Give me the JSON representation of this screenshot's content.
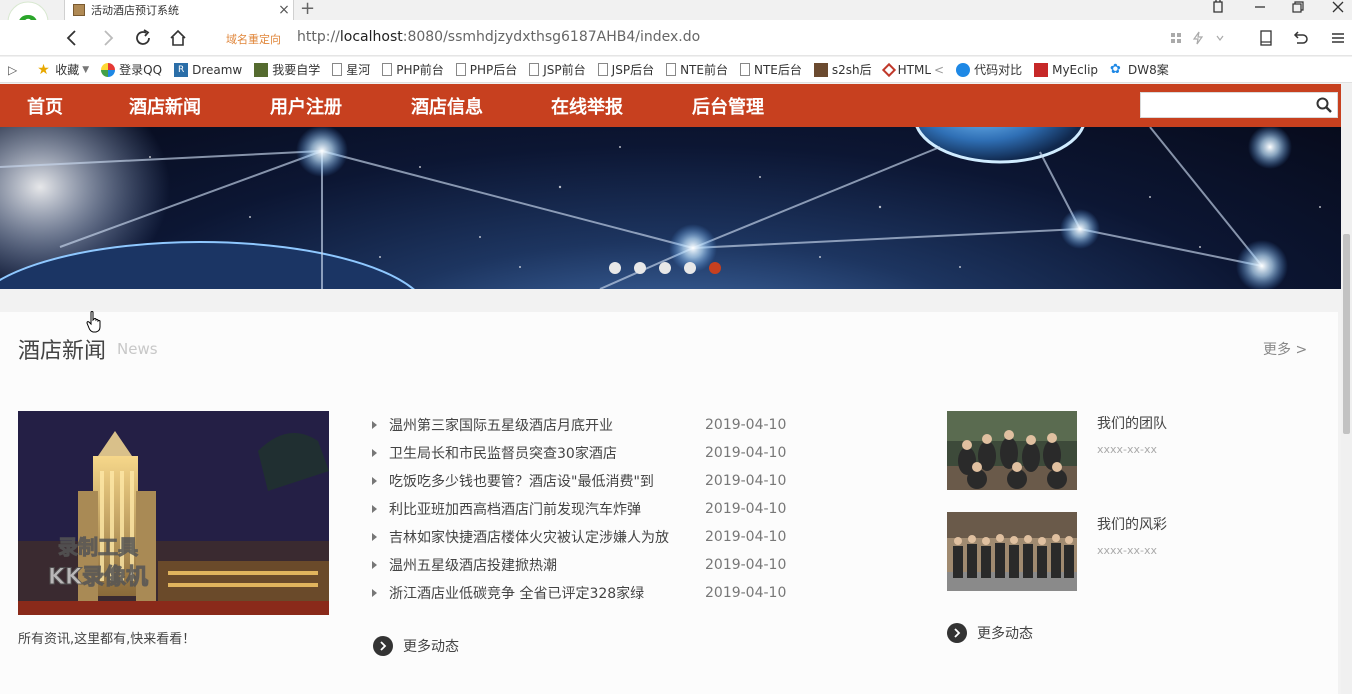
{
  "browser": {
    "tab_title": "活动酒店预订系统",
    "redirect_label": "域名重定向",
    "url_prefix": "http://",
    "url_host": "localhost",
    "url_rest": ":8080/ssmhdjzydxthsg6187AHB4/index.do",
    "bookmarks": [
      {
        "label": "收藏",
        "icon": "star-icon"
      },
      {
        "label": "登录QQ",
        "icon": "qq-icon"
      },
      {
        "label": "Dreamw",
        "icon": "dreamweaver-icon"
      },
      {
        "label": "我要自学",
        "icon": "site-icon"
      },
      {
        "label": "星河",
        "icon": "doc-icon"
      },
      {
        "label": "PHP前台",
        "icon": "doc-icon"
      },
      {
        "label": "PHP后台",
        "icon": "doc-icon"
      },
      {
        "label": "JSP前台",
        "icon": "doc-icon"
      },
      {
        "label": "JSP后台",
        "icon": "doc-icon"
      },
      {
        "label": "NTE前台",
        "icon": "doc-icon"
      },
      {
        "label": "NTE后台",
        "icon": "doc-icon"
      },
      {
        "label": "s2sh后",
        "icon": "site-icon"
      },
      {
        "label": "HTML",
        "icon": "html-icon"
      },
      {
        "label": "代码对比",
        "icon": "compare-icon"
      },
      {
        "label": "MyEclip",
        "icon": "myeclipse-icon"
      },
      {
        "label": "DW8案",
        "icon": "paw-icon"
      }
    ]
  },
  "nav": {
    "items": [
      "首页",
      "酒店新闻",
      "用户注册",
      "酒店信息",
      "在线举报",
      "后台管理"
    ],
    "search_placeholder": ""
  },
  "banner": {
    "dots": [
      false,
      false,
      false,
      false,
      true
    ]
  },
  "news_section": {
    "title": "酒店新闻",
    "subtitle": "News",
    "more": "更多 >",
    "feature_caption": "所有资讯,这里都有,快来看看！",
    "watermark_line1": "录制工具",
    "watermark_line2": "KK录像机",
    "items": [
      {
        "title": "温州第三家国际五星级酒店月底开业",
        "date": "2019-04-10"
      },
      {
        "title": "卫生局长和市民监督员突查30家酒店",
        "date": "2019-04-10"
      },
      {
        "title": "吃饭吃多少钱也要管？酒店设\"最低消费\"到",
        "date": "2019-04-10"
      },
      {
        "title": "利比亚班加西高档酒店门前发现汽车炸弹",
        "date": "2019-04-10"
      },
      {
        "title": "吉林如家快捷酒店楼体火灾被认定涉嫌人为放",
        "date": "2019-04-10"
      },
      {
        "title": "温州五星级酒店投建掀热潮",
        "date": "2019-04-10"
      },
      {
        "title": "浙江酒店业低碳竞争 全省已评定328家绿",
        "date": "2019-04-10"
      }
    ],
    "more_news": "更多动态",
    "side": [
      {
        "title": "我们的团队",
        "date": "xxxx-xx-xx"
      },
      {
        "title": "我们的风彩",
        "date": "xxxx-xx-xx"
      }
    ],
    "side_more": "更多动态"
  },
  "colors": {
    "nav_bg": "#c7401f",
    "active_dot": "#c7401f"
  }
}
